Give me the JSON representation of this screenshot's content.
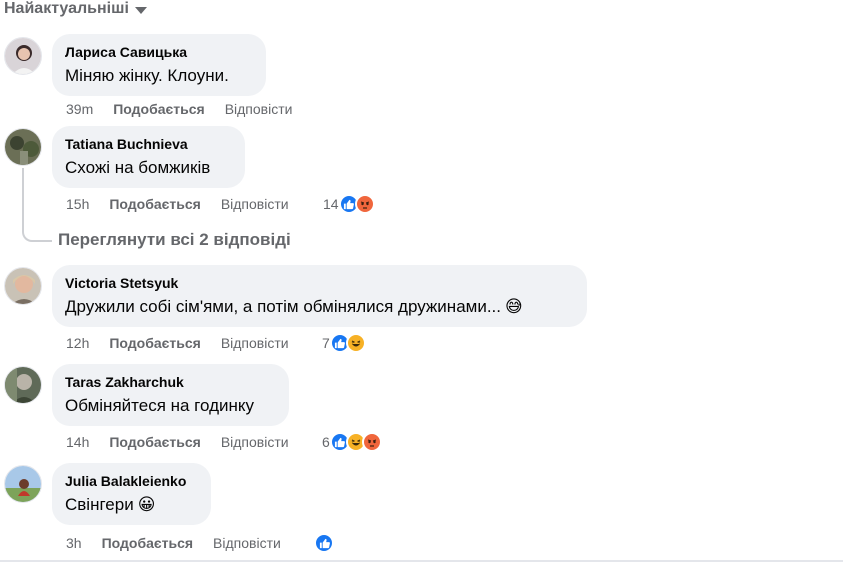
{
  "sort": {
    "label": "Найактуальніші",
    "icon": "caret-down-icon"
  },
  "actions": {
    "like": "Подобається",
    "reply": "Відповісти"
  },
  "view_replies": "Переглянути всі 2 відповіді",
  "comments": [
    {
      "author": "Лариса Савицька",
      "text": "Міняю жінку. Клоуни.",
      "time": "39m",
      "reaction_count": "",
      "reactions": []
    },
    {
      "author": "Tatiana Buchnieva",
      "text": "Схожі на бомжиків",
      "time": "15h",
      "reaction_count": "14",
      "reactions": [
        "like-reaction-icon",
        "angry-reaction-icon"
      ]
    },
    {
      "author": "Victoria Stetsyuk",
      "text": "Дружили собі сім'ями, а потім обмінялися дружинами...",
      "emoji": "😅",
      "time": "12h",
      "reaction_count": "7",
      "reactions": [
        "like-reaction-icon",
        "haha-reaction-icon"
      ]
    },
    {
      "author": "Taras Zakharchuk",
      "text": "Обміняйтеся на годинку",
      "time": "14h",
      "reaction_count": "6",
      "reactions": [
        "like-reaction-icon",
        "haha-reaction-icon",
        "angry-reaction-icon"
      ]
    },
    {
      "author": "Julia Balakleienko",
      "text": "Свінгери",
      "emoji": "😀",
      "time": "3h",
      "reaction_count": "",
      "reactions": [
        "like-reaction-icon"
      ]
    }
  ],
  "colors": {
    "bubble": "#f0f2f5",
    "secondary_text": "#65676b",
    "like_blue": "#1877f2",
    "haha_yellow": "#f7b125",
    "angry_orange": "#f0663c"
  }
}
